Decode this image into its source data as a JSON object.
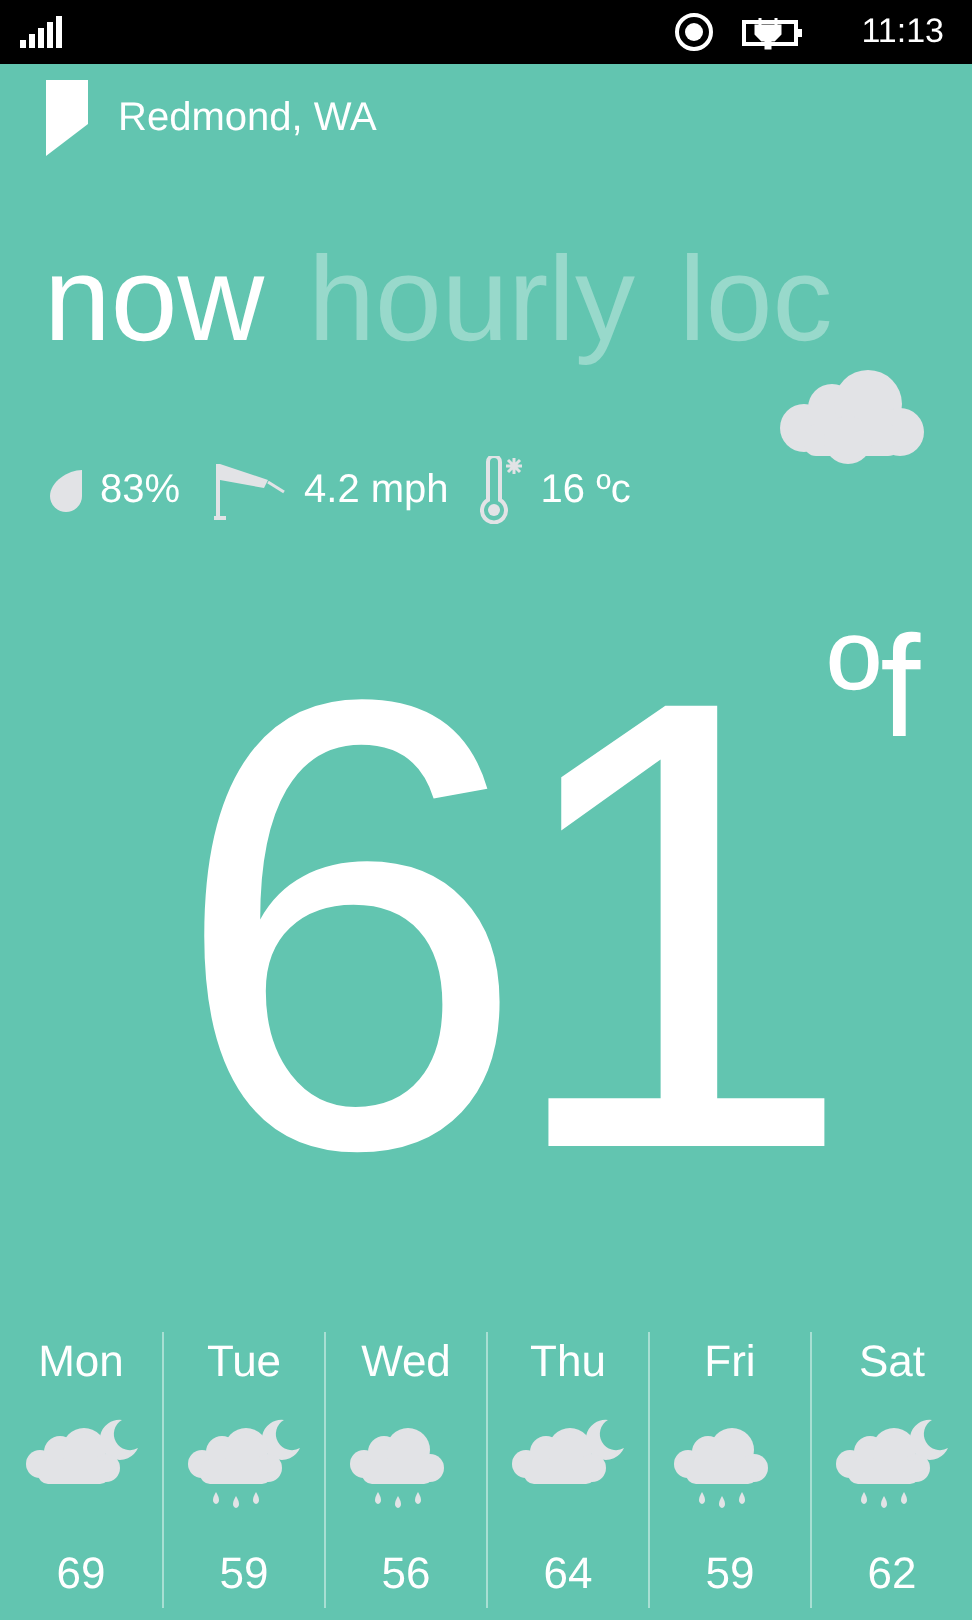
{
  "status_bar": {
    "time": "11:13"
  },
  "location": "Redmond, WA",
  "pivot": [
    {
      "label": "now",
      "selected": true
    },
    {
      "label": "hourly",
      "selected": false
    },
    {
      "label": "loc",
      "selected": false
    }
  ],
  "current": {
    "kind": "cloudy",
    "humidity": "83%",
    "wind": "4.2 mph",
    "feels_like": "16 ºc",
    "temperature": "61",
    "unit": "ºf"
  },
  "forecast": [
    {
      "day": "Mon",
      "kind": "night-cloudy",
      "temp": "69"
    },
    {
      "day": "Tue",
      "kind": "night-rain",
      "temp": "59"
    },
    {
      "day": "Wed",
      "kind": "rain",
      "temp": "56"
    },
    {
      "day": "Thu",
      "kind": "night-cloudy",
      "temp": "64"
    },
    {
      "day": "Fri",
      "kind": "rain",
      "temp": "59"
    },
    {
      "day": "Sat",
      "kind": "night-rain",
      "temp": "62"
    }
  ]
}
